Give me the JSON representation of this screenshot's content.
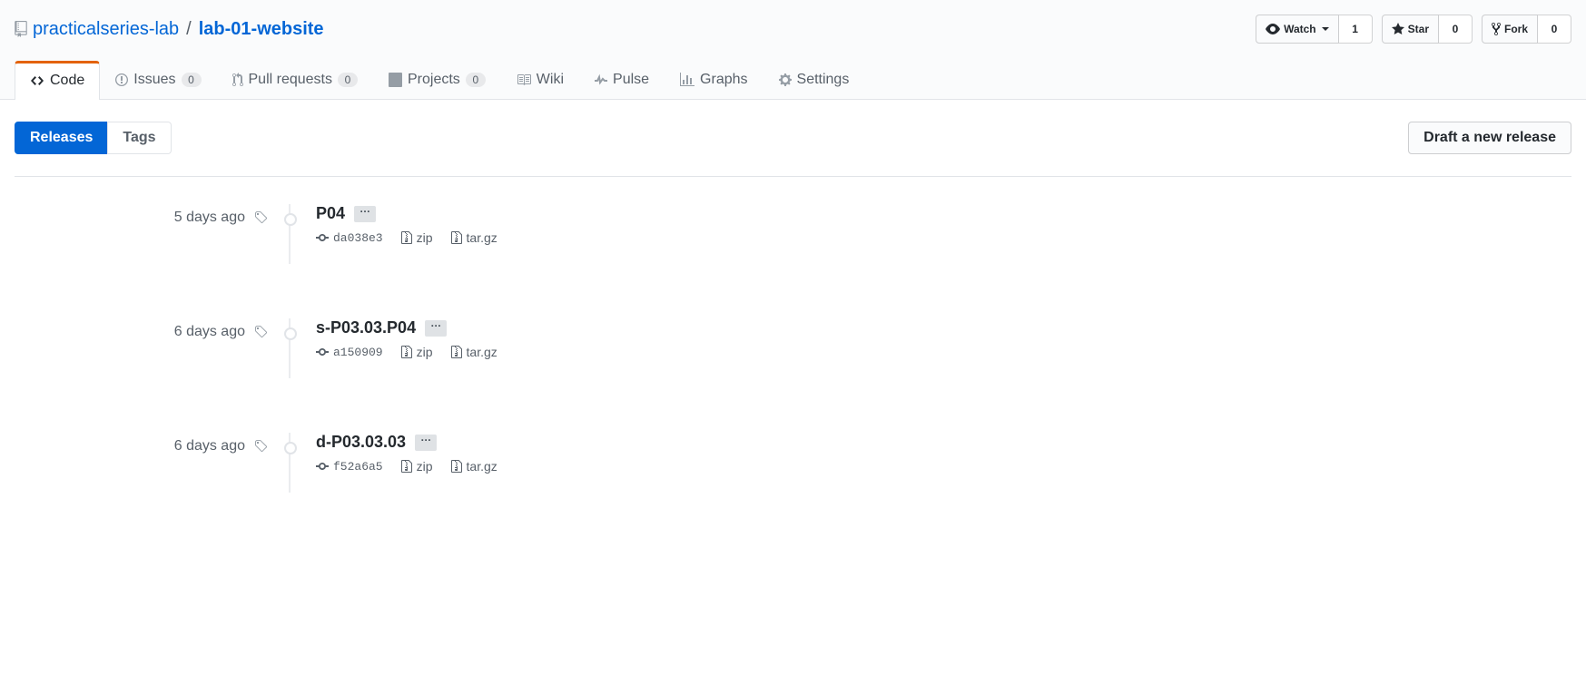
{
  "repo": {
    "owner": "practicalseries-lab",
    "name": "lab-01-website"
  },
  "actions": {
    "watch": {
      "label": "Watch",
      "count": "1"
    },
    "star": {
      "label": "Star",
      "count": "0"
    },
    "fork": {
      "label": "Fork",
      "count": "0"
    }
  },
  "nav": {
    "code": "Code",
    "issues": {
      "label": "Issues",
      "count": "0"
    },
    "pulls": {
      "label": "Pull requests",
      "count": "0"
    },
    "projects": {
      "label": "Projects",
      "count": "0"
    },
    "wiki": "Wiki",
    "pulse": "Pulse",
    "graphs": "Graphs",
    "settings": "Settings"
  },
  "subnav": {
    "releases": "Releases",
    "tags": "Tags",
    "draft_button": "Draft a new release"
  },
  "dl_labels": {
    "zip": "zip",
    "targz": "tar.gz"
  },
  "ellipsis": "…",
  "releases": [
    {
      "age": "5 days ago",
      "title": "P04",
      "commit": "da038e3"
    },
    {
      "age": "6 days ago",
      "title": "s-P03.03.P04",
      "commit": "a150909"
    },
    {
      "age": "6 days ago",
      "title": "d-P03.03.03",
      "commit": "f52a6a5"
    }
  ]
}
